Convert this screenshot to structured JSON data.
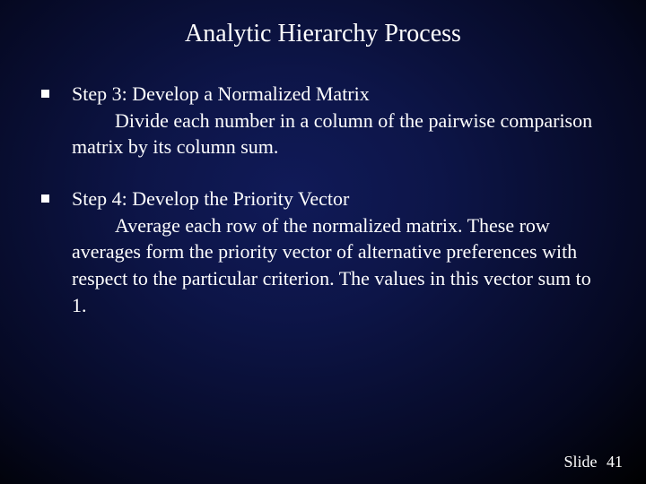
{
  "title": "Analytic Hierarchy Process",
  "bullets": [
    {
      "heading": "Step 3:  Develop a Normalized Matrix",
      "body": "Divide each number in a column of the pairwise comparison matrix by its column sum."
    },
    {
      "heading": "Step 4:  Develop the Priority Vector",
      "body": "Average each row of the normalized matrix.  These row averages form the priority vector of alternative preferences with respect to the particular criterion.  The values in this vector sum to 1."
    }
  ],
  "footer": {
    "label": "Slide",
    "number": "41"
  }
}
